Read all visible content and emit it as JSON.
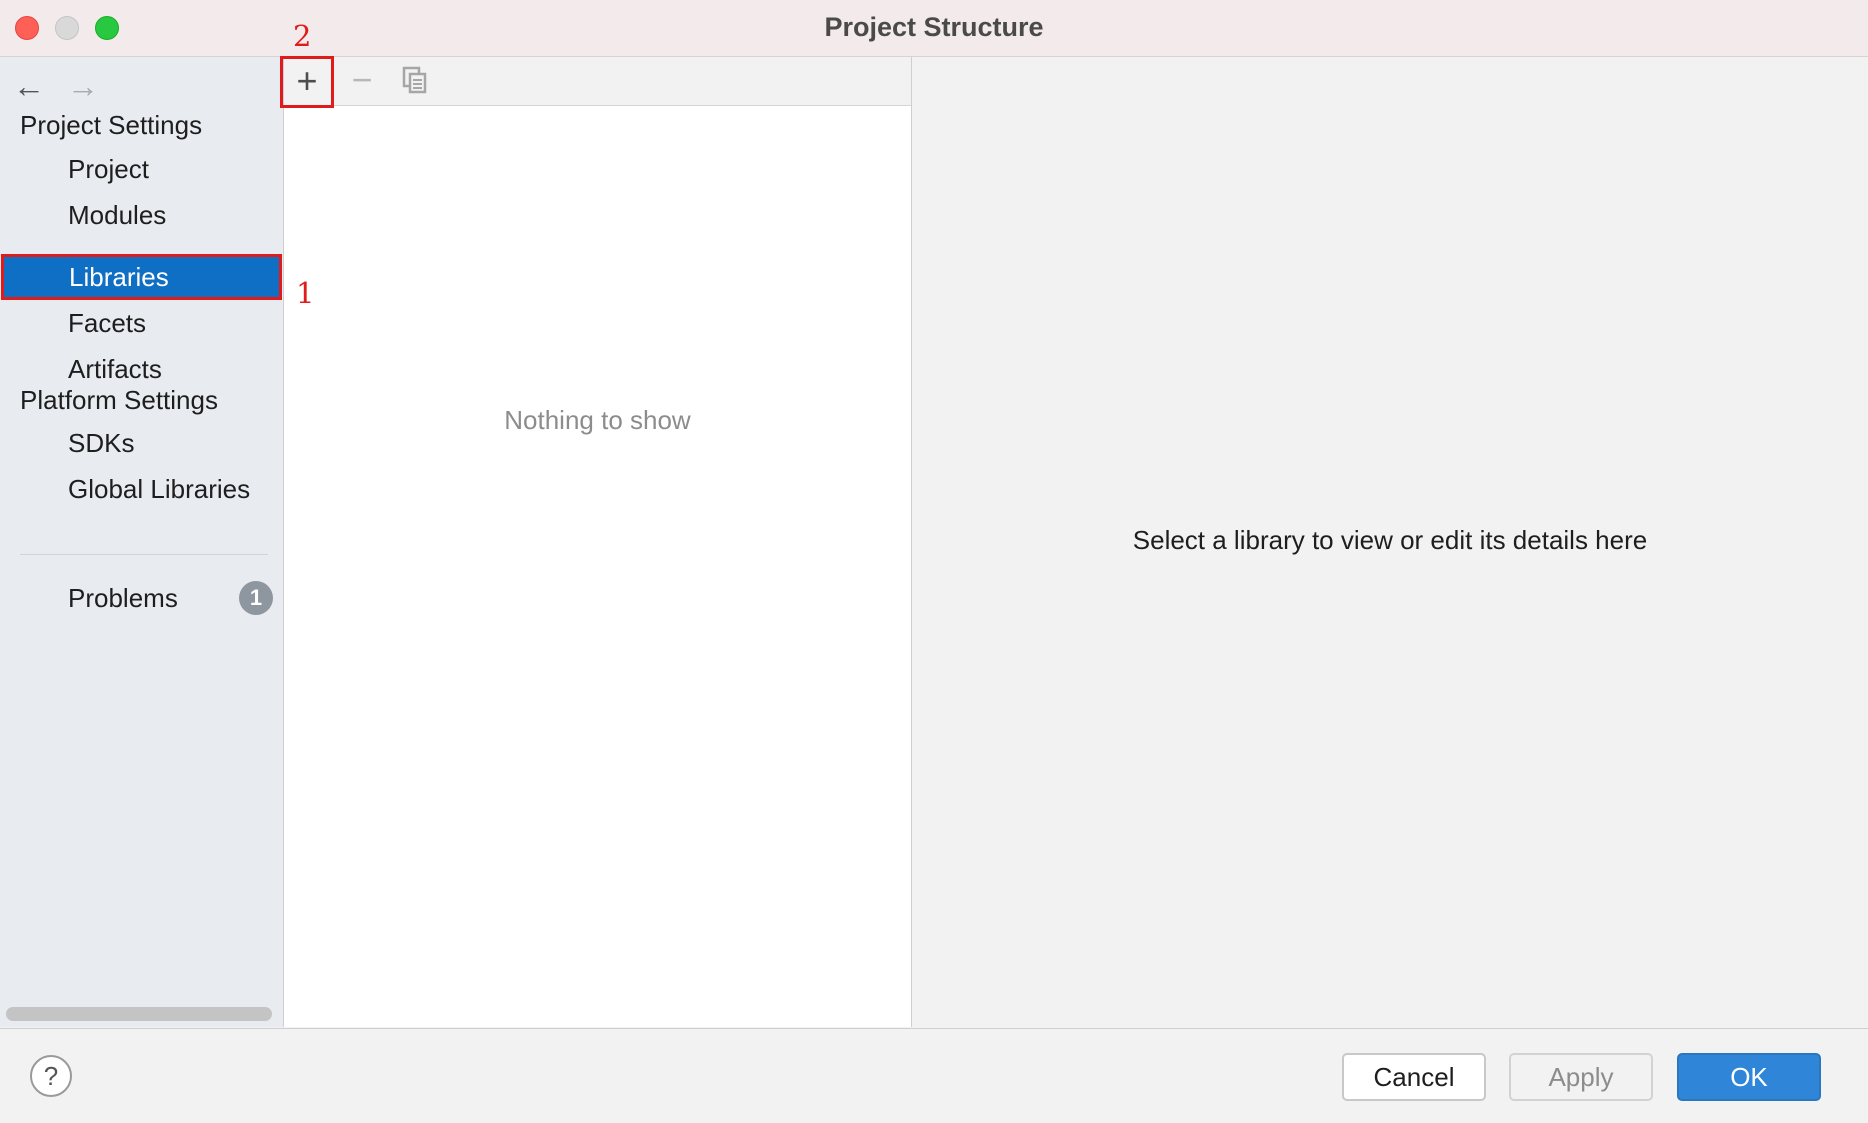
{
  "window": {
    "title": "Project Structure",
    "traffic_lights": [
      "close",
      "minimize",
      "zoom"
    ]
  },
  "sidebar": {
    "nav": {
      "back_icon": "arrow-left-icon",
      "forward_icon": "arrow-right-icon"
    },
    "sections": [
      {
        "header": "Project Settings",
        "items": [
          {
            "label": "Project"
          },
          {
            "label": "Modules"
          },
          {
            "label": "Libraries",
            "selected": true
          },
          {
            "label": "Facets"
          },
          {
            "label": "Artifacts"
          }
        ]
      },
      {
        "header": "Platform Settings",
        "items": [
          {
            "label": "SDKs"
          },
          {
            "label": "Global Libraries"
          }
        ]
      }
    ],
    "problems": {
      "label": "Problems",
      "count": "1"
    }
  },
  "list_panel": {
    "toolbar": {
      "add_icon": "plus-icon",
      "remove_icon": "minus-icon",
      "copy_icon": "copy-icon"
    },
    "empty_text": "Nothing to show"
  },
  "detail_panel": {
    "text": "Select a library to view or edit its details here"
  },
  "annotations": {
    "step1": "1",
    "step2": "2",
    "color": "#e01b1b"
  },
  "footer": {
    "help_label": "?",
    "cancel_label": "Cancel",
    "apply_label": "Apply",
    "ok_label": "OK"
  },
  "colors": {
    "selection": "#0f6fc4",
    "ok_button": "#2f86d8",
    "sidebar_bg": "#e8ebf0"
  }
}
